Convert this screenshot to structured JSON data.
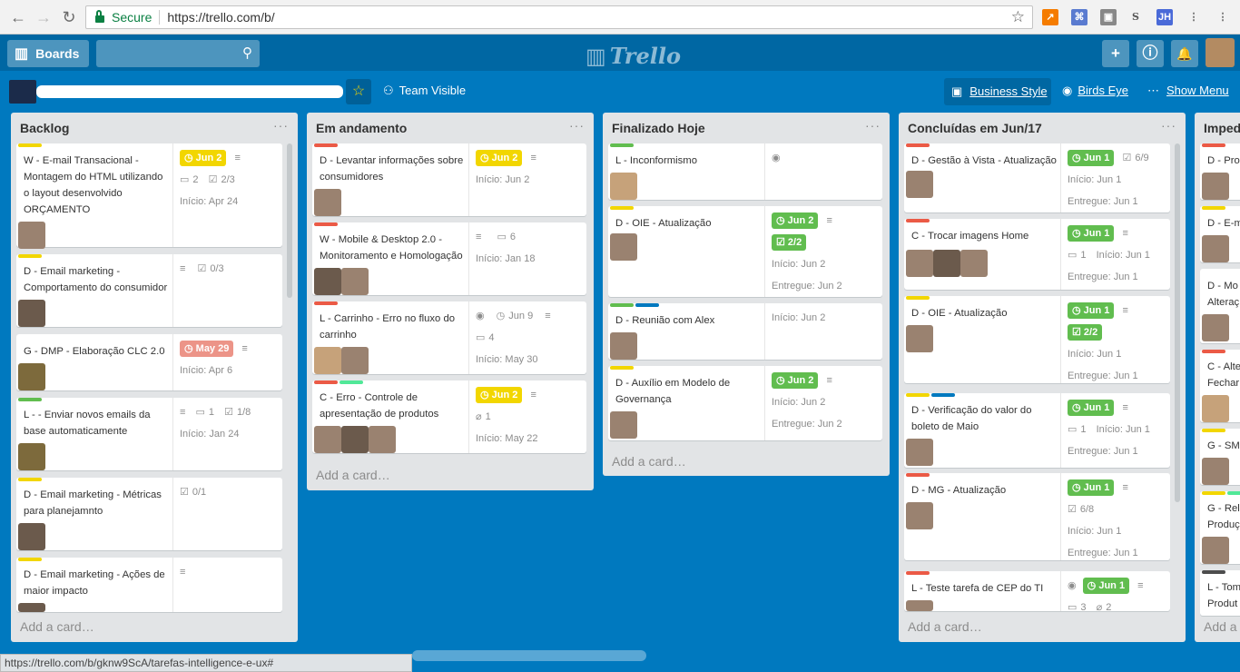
{
  "browser": {
    "secure_label": "Secure",
    "url": "https://trello.com/b/"
  },
  "header": {
    "boards_label": "Boards",
    "logo": "Trello"
  },
  "board": {
    "visibility": "Team Visible",
    "business_style": "Business Style",
    "birds_eye": "Birds Eye",
    "show_menu": "Show Menu"
  },
  "lists": [
    {
      "title": "Backlog",
      "add_card": "Add a card…",
      "cards": [
        {
          "title": "W - E-mail Transacional - Montagem do HTML utilizando o layout desenvolvido ORÇAMENTO",
          "due": "Jun 2",
          "comments": "2",
          "checklist": "2/3",
          "start": "Início: Apr 24"
        },
        {
          "title": "D - Email marketing - Comportamento do consumidor",
          "checklist": "0/3"
        },
        {
          "title": "G - DMP - Elaboração CLC 2.0",
          "due": "May 29",
          "start": "Início: Apr 6"
        },
        {
          "title": "L -        - Enviar novos emails da base automaticamente",
          "comments": "1",
          "checklist": "1/8",
          "start": "Início: Jan 24"
        },
        {
          "title": "D - Email marketing - Métricas para planejamnto",
          "checklist": "0/1"
        },
        {
          "title": "D - Email marketing - Ações de maior impacto"
        }
      ]
    },
    {
      "title": "Em andamento",
      "add_card": "Add a card…",
      "cards": [
        {
          "title": "D - Levantar informações sobre consumidores",
          "due": "Jun 2",
          "start": "Início: Jun 2"
        },
        {
          "title": "W - Mobile & Desktop 2.0 - Monitoramento e Homologação",
          "comments": "6",
          "start": "Início: Jan 18"
        },
        {
          "title": "L - Carrinho - Erro no fluxo do carrinho",
          "due": "Jun 9",
          "comments": "4",
          "start": "Início: May 30"
        },
        {
          "title": "C - Erro - Controle de apresentação de produtos",
          "due": "Jun 2",
          "attachments": "1",
          "start": "Início: May 22"
        }
      ]
    },
    {
      "title": "Finalizado Hoje",
      "add_card": "Add a card…",
      "cards": [
        {
          "title": "L - Inconformismo"
        },
        {
          "title": "D - OIE - Atualização",
          "due": "Jun 2",
          "checklist": "2/2",
          "start": "Início: Jun 2",
          "delivered": "Entregue: Jun 2"
        },
        {
          "title": "D - Reunião com Alex",
          "start": "Início: Jun 2"
        },
        {
          "title": "D - Auxílio em Modelo de Governança",
          "due": "Jun 2",
          "start": "Início: Jun 2",
          "delivered": "Entregue: Jun 2"
        }
      ]
    },
    {
      "title": "Concluídas em Jun/17",
      "add_card": "Add a card…",
      "cards": [
        {
          "title": "D - Gestão à Vista - Atualização",
          "due": "Jun 1",
          "checklist": "6/9",
          "start": "Início: Jun 1",
          "delivered": "Entregue: Jun 1"
        },
        {
          "title": "C - Trocar imagens Home",
          "due": "Jun 1",
          "comments": "1",
          "start": "Início: Jun 1",
          "delivered": "Entregue: Jun 1"
        },
        {
          "title": "D - OIE - Atualização",
          "due": "Jun 1",
          "checklist": "2/2",
          "start": "Início: Jun 1",
          "delivered": "Entregue: Jun 1"
        },
        {
          "title": "D          - Verificação do valor do boleto de Maio",
          "due": "Jun 1",
          "comments": "1",
          "start": "Início: Jun 1",
          "delivered": "Entregue: Jun 1"
        },
        {
          "title": "D - MG - Atualização",
          "due": "Jun 1",
          "checklist": "6/8",
          "start": "Início: Jun 1",
          "delivered": "Entregue: Jun 1"
        },
        {
          "title": "L - Teste tarefa de CEP do TI",
          "due": "Jun 1",
          "comments": "3",
          "attachments": "2"
        }
      ]
    },
    {
      "title": "Imped",
      "add_card": "Add a",
      "cards": [
        {
          "title": "D - Pro"
        },
        {
          "title": "D - E-m"
        },
        {
          "title": "D - Mo Alteraç"
        },
        {
          "title": "C - Alte Fechar"
        },
        {
          "title": "G - SM"
        },
        {
          "title": "G - Rel Produç"
        },
        {
          "title": "L - Tom Produt"
        }
      ]
    }
  ],
  "statusbar": "https://trello.com/b/gknw9ScA/tarefas-intelligence-e-ux#",
  "colors": {
    "board_bg": "#0079bf",
    "green": "#61bd4f",
    "yellow": "#f2d600",
    "red": "#eb5a46",
    "blue": "#0079bf"
  }
}
